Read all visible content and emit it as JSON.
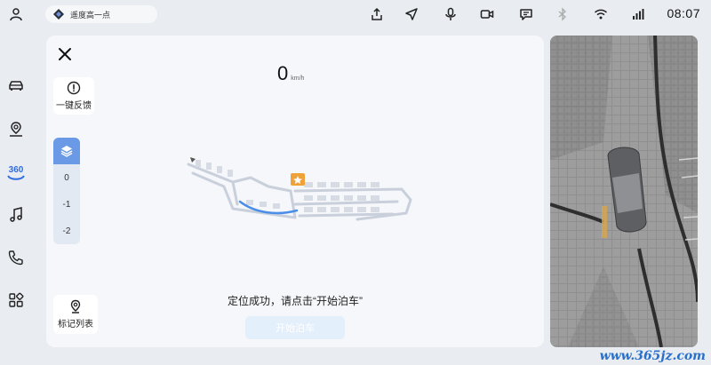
{
  "status_bar": {
    "search_text": "遥度高一点",
    "time": "08:07",
    "icons": [
      "user-icon",
      "upload-icon",
      "navigation-icon",
      "mic-icon",
      "camera-icon",
      "message-icon",
      "bluetooth-icon",
      "wifi-icon",
      "signal-icon"
    ]
  },
  "left_nav": {
    "items": [
      "car-icon",
      "location-user-icon",
      "360-icon",
      "music-icon",
      "phone-icon",
      "apps-icon"
    ],
    "active_label": "360"
  },
  "main": {
    "speed_value": "0",
    "speed_unit": "km/h",
    "feedback_label": "一键反馈",
    "floors": [
      "0",
      "-1",
      "-2"
    ],
    "mark_list_label": "标记列表",
    "message": "定位成功，请点击“开始泊车”",
    "start_button": "开始泊车"
  },
  "watermark": "www.365jz.com",
  "colors": {
    "accent": "#6a9ae6",
    "route": "#4a8ee8",
    "marker": "#f0a23a"
  }
}
